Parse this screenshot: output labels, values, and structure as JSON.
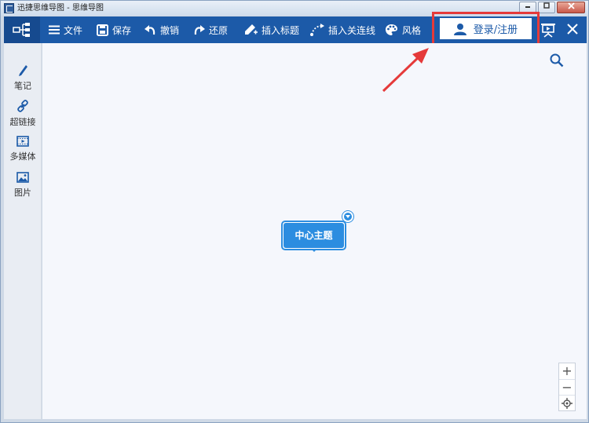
{
  "window": {
    "title": "迅捷思维导图 - 思维导图",
    "minimize_glyph": "0",
    "maximize_glyph": "1",
    "close_glyph": "x"
  },
  "toolbar": {
    "file_label": "文件",
    "save_label": "保存",
    "undo_label": "撤销",
    "redo_label": "还原",
    "insert_topic_label": "插入标题",
    "insert_connector_label": "插入关连线",
    "style_label": "风格",
    "login_label": "登录/注册"
  },
  "sidebar": {
    "items": [
      {
        "label": "笔记",
        "icon": "pencil-icon"
      },
      {
        "label": "超链接",
        "icon": "link-icon"
      },
      {
        "label": "多媒体",
        "icon": "film-icon"
      },
      {
        "label": "图片",
        "icon": "image-icon"
      }
    ]
  },
  "canvas": {
    "central_topic": "中心主题"
  },
  "zoom": {
    "zoom_in": "+",
    "zoom_out": "−"
  },
  "colors": {
    "toolbar_bg": "#1c5aa8",
    "node_fill": "#2c8de0",
    "highlight": "#e53a3a",
    "canvas_bg": "#f5f7fc"
  }
}
